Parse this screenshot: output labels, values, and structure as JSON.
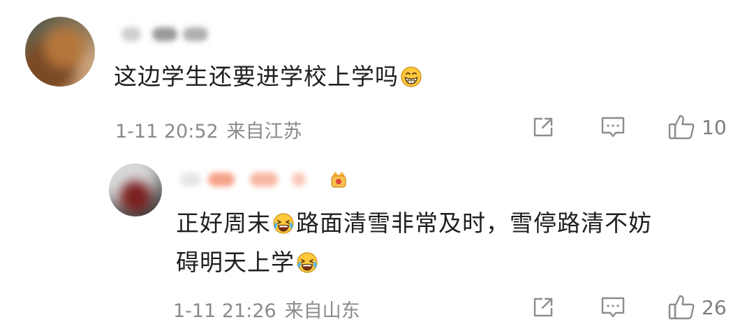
{
  "comments": [
    {
      "username": "",
      "text": "这边学生还要进学校上学吗",
      "emoji": "grin-emoji",
      "time": "1-11 20:52",
      "location": "来自江苏",
      "like_count": "10",
      "avatar_color": "#a08463"
    },
    {
      "username": "",
      "text_line1_a": "正好周末",
      "text_line1_b": "路面清雪非常及时，雪停路清不妨",
      "text_line2": "碍明天上学",
      "emoji": "laugh-cry-emoji",
      "time": "1-11 21:26",
      "location": "来自山东",
      "like_count": "26",
      "avatar_color": "#5a5a5a"
    }
  ],
  "icons": {
    "share": "share-icon",
    "reply": "comment-reply-icon",
    "like": "thumbs-up-icon"
  },
  "colors": {
    "meta_text": "#8a8a8a",
    "icon_stroke": "#8c8c8c",
    "emoji_face": "#ffc83d"
  }
}
